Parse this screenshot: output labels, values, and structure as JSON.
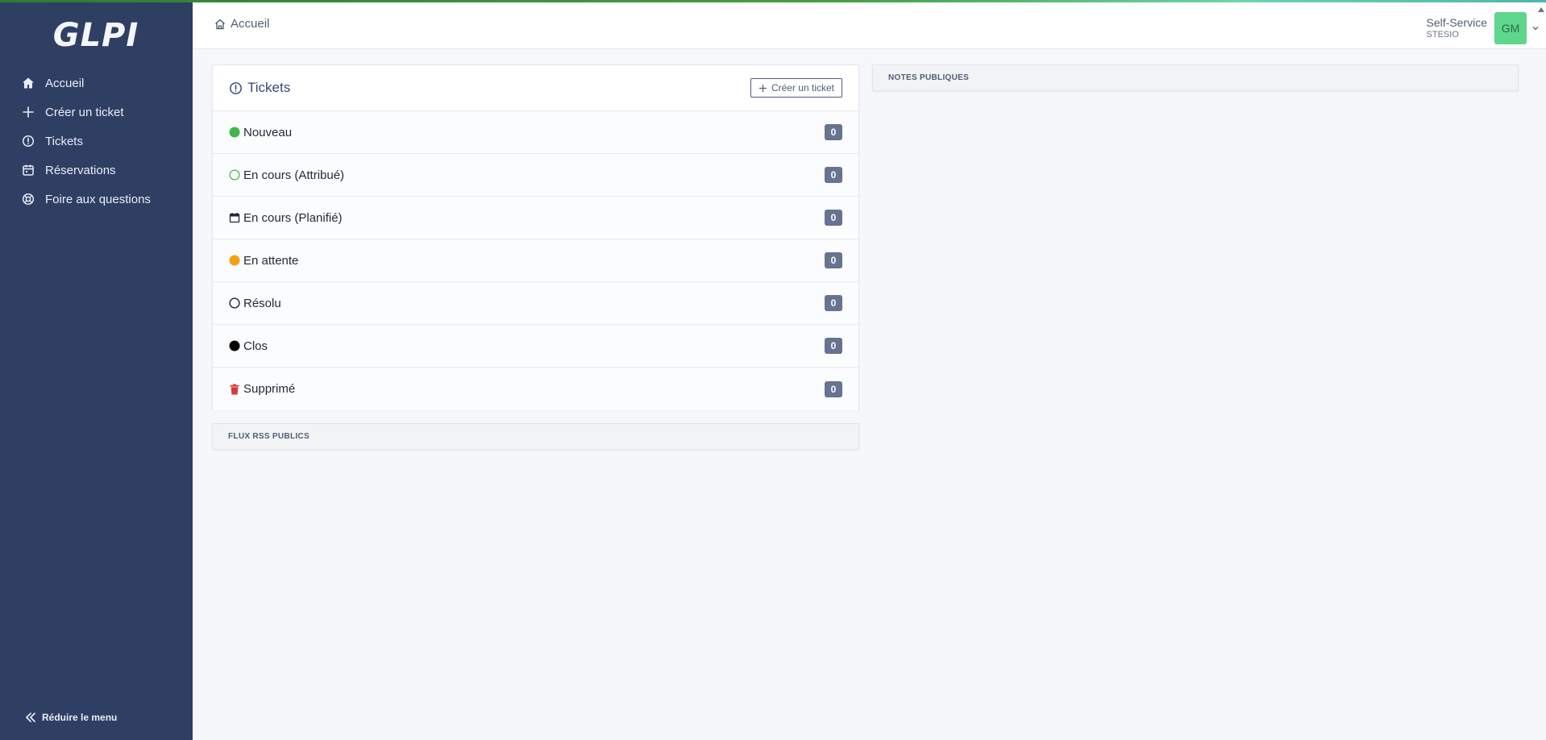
{
  "app": {
    "logo": "GLPI"
  },
  "sidebar": {
    "items": [
      {
        "label": "Accueil",
        "icon": "home-icon"
      },
      {
        "label": "Créer un ticket",
        "icon": "plus-icon"
      },
      {
        "label": "Tickets",
        "icon": "alert-circle-icon"
      },
      {
        "label": "Réservations",
        "icon": "calendar-icon"
      },
      {
        "label": "Foire aux questions",
        "icon": "lifebuoy-icon"
      }
    ],
    "collapse_label": "Réduire le menu"
  },
  "header": {
    "breadcrumb": "Accueil",
    "profile_name": "Self-Service",
    "profile_entity": "STESIO",
    "avatar_initials": "GM",
    "avatar_color": "#5ed68c"
  },
  "tickets": {
    "title": "Tickets",
    "create_label": "Créer un ticket",
    "statuses": [
      {
        "label": "Nouveau",
        "count": "0",
        "icon": "status-new-icon",
        "color": "#3fb84a"
      },
      {
        "label": "En cours (Attribué)",
        "count": "0",
        "icon": "status-assigned-icon",
        "color": "#3fb84a"
      },
      {
        "label": "En cours (Planifié)",
        "count": "0",
        "icon": "status-planned-icon",
        "color": "#1e293b"
      },
      {
        "label": "En attente",
        "count": "0",
        "icon": "status-waiting-icon",
        "color": "#f5a00f"
      },
      {
        "label": "Résolu",
        "count": "0",
        "icon": "status-solved-icon",
        "color": "#1e293b"
      },
      {
        "label": "Clos",
        "count": "0",
        "icon": "status-closed-icon",
        "color": "#000000"
      },
      {
        "label": "Supprimé",
        "count": "0",
        "icon": "trash-icon",
        "color": "#d63939"
      }
    ]
  },
  "panels": {
    "rss": "FLUX RSS PUBLICS",
    "notes": "NOTES PUBLIQUES"
  }
}
